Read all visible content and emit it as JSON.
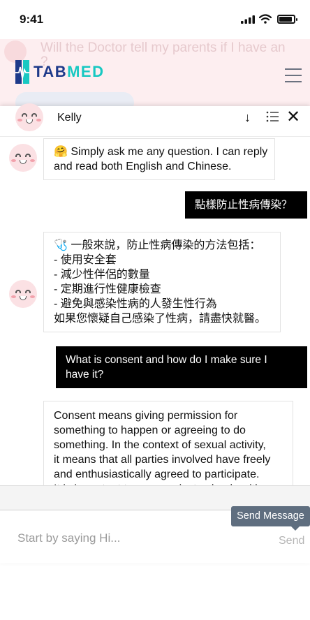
{
  "status_bar": {
    "time": "9:41"
  },
  "header": {
    "logo_tab": "TAB",
    "logo_med": "MED",
    "background_preview_text": "Will the Doctor tell my parents if I have an",
    "background_preview_text2": "?"
  },
  "chat": {
    "agent_name": "Kelly",
    "messages": [
      {
        "from": "bot",
        "text": "🤗 Simply ask me any question. I can reply\nand read both English and Chinese."
      },
      {
        "from": "user",
        "text": "點樣防止性病傳染？"
      },
      {
        "from": "bot",
        "text": "🩺 一般來說，防止性病傳染的方法包括：\n- 使用安全套\n- 減少性伴侶的數量\n- 定期進行性健康檢查\n- 避免與感染性病的人發生性行為\n如果您懷疑自己感染了性病，請盡快就醫。"
      },
      {
        "from": "user",
        "text": "What is consent and how do I make sure I\nhave it?"
      },
      {
        "from": "bot",
        "text": "Consent means giving permission for\nsomething to happen or agreeing to do\nsomething. In the context of sexual activity,\nit means that all parties involved have freely\nand enthusiastically agreed to participate.\nIt is important to communicate clearly with"
      }
    ],
    "tooltip": "Send Message",
    "input_placeholder": "Start by saying Hi...",
    "send_label": "Send"
  },
  "colors": {
    "brand_navy": "#1e3a8a",
    "brand_teal": "#18c8c2",
    "header_bg": "#fdeef0",
    "tooltip_bg": "#5f6e7f"
  }
}
